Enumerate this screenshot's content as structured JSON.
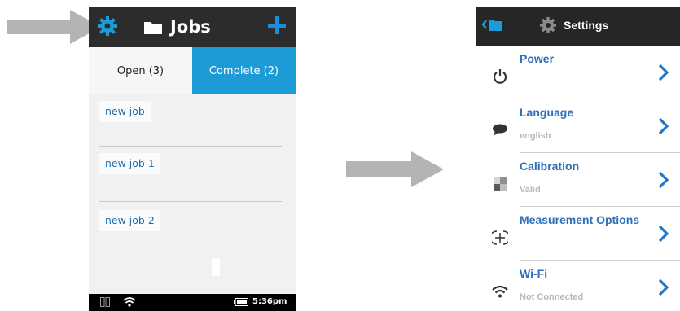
{
  "jobs_screen": {
    "title": "Jobs",
    "tabs": [
      {
        "label": "Open (3)",
        "active": true
      },
      {
        "label": "Complete (2)",
        "active": false
      }
    ],
    "jobs": [
      "new job",
      "new job 1",
      "new job 2"
    ],
    "status_bar": {
      "time": "5:36pm"
    }
  },
  "settings_screen": {
    "title": "Settings",
    "items": [
      {
        "label": "Power",
        "value": "",
        "icon": "power-icon"
      },
      {
        "label": "Language",
        "value": "english",
        "icon": "speech-bubble-icon"
      },
      {
        "label": "Calibration",
        "value": "Valid",
        "icon": "calibration-icon"
      },
      {
        "label": "Measurement Options",
        "value": "",
        "icon": "crosshair-icon"
      },
      {
        "label": "Wi-Fi",
        "value": "Not Connected",
        "icon": "wifi-icon"
      }
    ]
  },
  "colors": {
    "accent": "#1d9bd7",
    "link": "#2f6fb7",
    "header": "#2c2c2c",
    "arrow": "#b4b4b4"
  }
}
